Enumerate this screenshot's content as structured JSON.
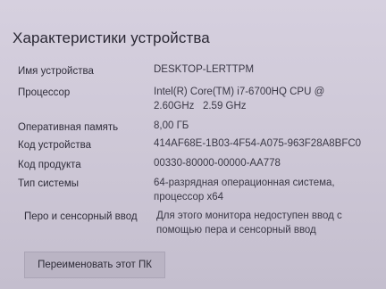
{
  "title": "Характеристики устройства",
  "rows": [
    {
      "label": "Имя устройства",
      "value": "DESKTOP-LERTTPM"
    },
    {
      "label": "Процессор",
      "value": "Intel(R) Core(TM) i7-6700HQ CPU @",
      "value2": "2.60GHz   2.59 GHz"
    },
    {
      "label": "Оперативная память",
      "value": "8,00 ГБ"
    },
    {
      "label": "Код устройства",
      "value": "414AF68E-1B03-4F54-A075-963F28A8BFC0"
    },
    {
      "label": "Код продукта",
      "value": "00330-80000-00000-AA778"
    },
    {
      "label": "Тип системы",
      "value": "64-разрядная операционная система,",
      "value2": "процессор x64"
    },
    {
      "label": "Перо и сенсорный ввод",
      "value": "Для этого монитора недоступен ввод с",
      "value2": "помощью пера и сенсорный ввод"
    }
  ],
  "rename_button": "Переименовать этот ПК"
}
